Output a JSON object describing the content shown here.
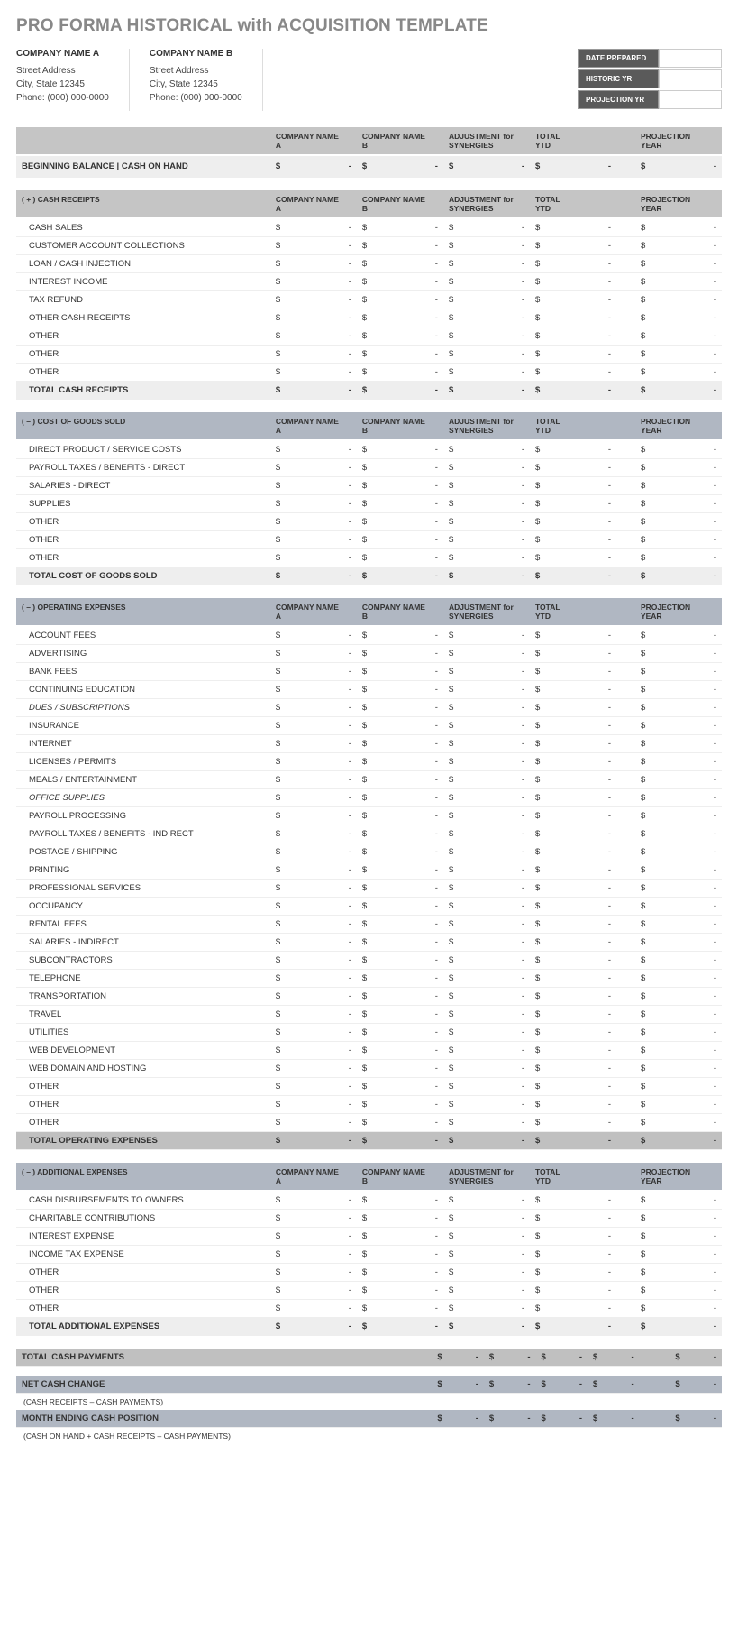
{
  "title": "PRO FORMA HISTORICAL with ACQUISITION TEMPLATE",
  "companyA": {
    "name": "COMPANY NAME A",
    "street": "Street Address",
    "city": "City, State  12345",
    "phone": "Phone: (000) 000-0000"
  },
  "companyB": {
    "name": "COMPANY NAME B",
    "street": "Street Address",
    "city": "City, State  12345",
    "phone": "Phone: (000) 000-0000"
  },
  "meta": {
    "datePrepared": {
      "label": "DATE PREPARED",
      "value": ""
    },
    "historicYr": {
      "label": "HISTORIC YR",
      "value": ""
    },
    "projectionYr": {
      "label": "PROJECTION YR",
      "value": ""
    }
  },
  "cols": [
    "COMPANY NAME A",
    "COMPANY NAME B",
    "ADJUSTMENT for SYNERGIES",
    "TOTAL YTD",
    "",
    "PROJECTION YEAR"
  ],
  "sections": [
    {
      "id": "beginning",
      "header": "",
      "rows": [
        {
          "label": "BEGINNING BALANCE | CASH ON HAND",
          "style": "hdr"
        }
      ]
    },
    {
      "id": "receipts",
      "header": "( + )  CASH RECEIPTS",
      "rows": [
        {
          "label": "CASH SALES"
        },
        {
          "label": "CUSTOMER ACCOUNT COLLECTIONS"
        },
        {
          "label": "LOAN / CASH INJECTION"
        },
        {
          "label": "INTEREST INCOME"
        },
        {
          "label": "TAX REFUND"
        },
        {
          "label": "OTHER CASH RECEIPTS"
        },
        {
          "label": "OTHER"
        },
        {
          "label": "OTHER"
        },
        {
          "label": "OTHER"
        },
        {
          "label": "TOTAL CASH RECEIPTS",
          "style": "total"
        }
      ]
    },
    {
      "id": "cogs",
      "header": "( – )  COST OF GOODS SOLD",
      "hdrClass": "sechdr",
      "rows": [
        {
          "label": "DIRECT PRODUCT / SERVICE COSTS"
        },
        {
          "label": "PAYROLL TAXES / BENEFITS - DIRECT"
        },
        {
          "label": "SALARIES - DIRECT"
        },
        {
          "label": "SUPPLIES"
        },
        {
          "label": "OTHER"
        },
        {
          "label": "OTHER"
        },
        {
          "label": "OTHER"
        },
        {
          "label": "TOTAL COST OF GOODS SOLD",
          "style": "total"
        }
      ]
    },
    {
      "id": "opex",
      "header": "( – )  OPERATING EXPENSES",
      "hdrClass": "sechdr",
      "rows": [
        {
          "label": "ACCOUNT FEES"
        },
        {
          "label": "ADVERTISING"
        },
        {
          "label": "BANK FEES"
        },
        {
          "label": "CONTINUING EDUCATION"
        },
        {
          "label": "DUES / SUBSCRIPTIONS",
          "italic": true
        },
        {
          "label": "INSURANCE"
        },
        {
          "label": "INTERNET"
        },
        {
          "label": "LICENSES / PERMITS"
        },
        {
          "label": "MEALS / ENTERTAINMENT"
        },
        {
          "label": "OFFICE SUPPLIES",
          "italic": true
        },
        {
          "label": "PAYROLL PROCESSING"
        },
        {
          "label": "PAYROLL TAXES / BENEFITS - INDIRECT"
        },
        {
          "label": "POSTAGE / SHIPPING"
        },
        {
          "label": "PRINTING"
        },
        {
          "label": "PROFESSIONAL SERVICES"
        },
        {
          "label": "OCCUPANCY"
        },
        {
          "label": "RENTAL FEES"
        },
        {
          "label": "SALARIES - INDIRECT"
        },
        {
          "label": "SUBCONTRACTORS"
        },
        {
          "label": "TELEPHONE"
        },
        {
          "label": "TRANSPORTATION"
        },
        {
          "label": "TRAVEL"
        },
        {
          "label": "UTILITIES"
        },
        {
          "label": "WEB DEVELOPMENT"
        },
        {
          "label": "WEB DOMAIN AND HOSTING"
        },
        {
          "label": "OTHER"
        },
        {
          "label": "OTHER"
        },
        {
          "label": "OTHER"
        },
        {
          "label": "TOTAL OPERATING EXPENSES",
          "style": "tot2"
        }
      ]
    },
    {
      "id": "addl",
      "header": "( – )  ADDITIONAL EXPENSES",
      "hdrClass": "sechdr",
      "rows": [
        {
          "label": "CASH DISBURSEMENTS TO OWNERS"
        },
        {
          "label": "CHARITABLE CONTRIBUTIONS"
        },
        {
          "label": "INTEREST EXPENSE"
        },
        {
          "label": "INCOME TAX EXPENSE"
        },
        {
          "label": "OTHER"
        },
        {
          "label": "OTHER"
        },
        {
          "label": "OTHER"
        },
        {
          "label": "TOTAL ADDITIONAL EXPENSES",
          "style": "total"
        }
      ]
    }
  ],
  "summary": [
    {
      "label": "TOTAL CASH PAYMENTS",
      "style": "tot2"
    },
    {
      "label": "NET CASH CHANGE",
      "style": "tot3"
    },
    {
      "note": "(CASH RECEIPTS – CASH PAYMENTS)"
    },
    {
      "label": "MONTH ENDING CASH POSITION",
      "style": "tot3"
    },
    {
      "note": "(CASH ON HAND + CASH RECEIPTS – CASH PAYMENTS)"
    }
  ]
}
